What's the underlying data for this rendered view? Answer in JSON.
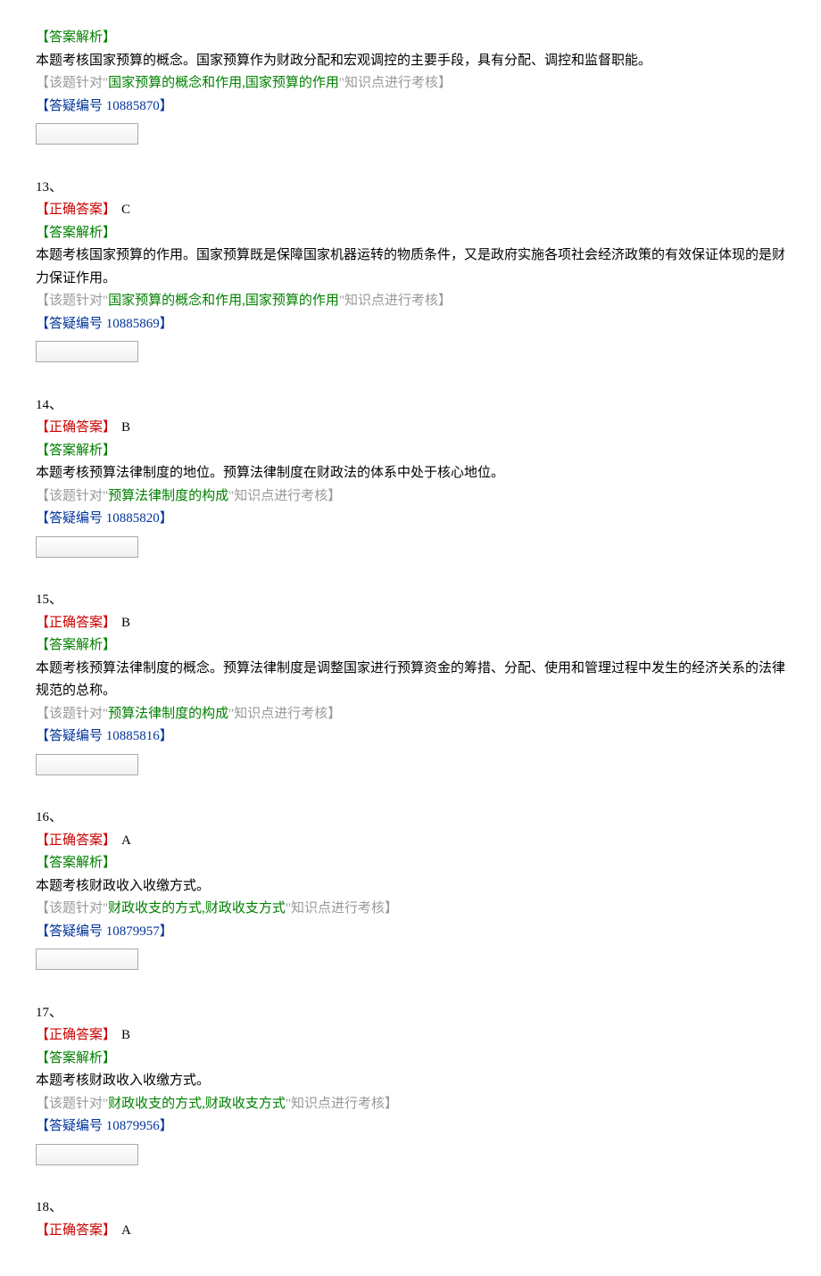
{
  "labels": {
    "analysis": "【答案解析】",
    "correct_answer": "【正确答案】",
    "knowledge_prefix": "【该题针对\"",
    "knowledge_suffix": "\"知识点进行考核】",
    "qa_prefix": "【答疑编号 ",
    "qa_suffix": "】"
  },
  "q12": {
    "analysis": "本题考核国家预算的概念。国家预算作为财政分配和宏观调控的主要手段，具有分配、调控和监督职能。",
    "knowledge": "国家预算的概念和作用,国家预算的作用",
    "qa_number": "10885870"
  },
  "q13": {
    "num": "13、",
    "answer": "C",
    "analysis": "本题考核国家预算的作用。国家预算既是保障国家机器运转的物质条件，又是政府实施各项社会经济政策的有效保证体现的是财力保证作用。",
    "knowledge": "国家预算的概念和作用,国家预算的作用",
    "qa_number": "10885869"
  },
  "q14": {
    "num": "14、",
    "answer": "B",
    "analysis": "本题考核预算法律制度的地位。预算法律制度在财政法的体系中处于核心地位。",
    "knowledge": "预算法律制度的构成",
    "qa_number": "10885820"
  },
  "q15": {
    "num": "15、",
    "answer": "B",
    "analysis": "本题考核预算法律制度的概念。预算法律制度是调整国家进行预算资金的筹措、分配、使用和管理过程中发生的经济关系的法律规范的总称。",
    "knowledge": "预算法律制度的构成",
    "qa_number": "10885816"
  },
  "q16": {
    "num": "16、",
    "answer": "A",
    "analysis": "本题考核财政收入收缴方式。",
    "knowledge": "财政收支的方式,财政收支方式",
    "qa_number": "10879957"
  },
  "q17": {
    "num": "17、",
    "answer": "B",
    "analysis": "本题考核财政收入收缴方式。",
    "knowledge": "财政收支的方式,财政收支方式",
    "qa_number": "10879956"
  },
  "q18": {
    "num": "18、",
    "answer": "A"
  }
}
